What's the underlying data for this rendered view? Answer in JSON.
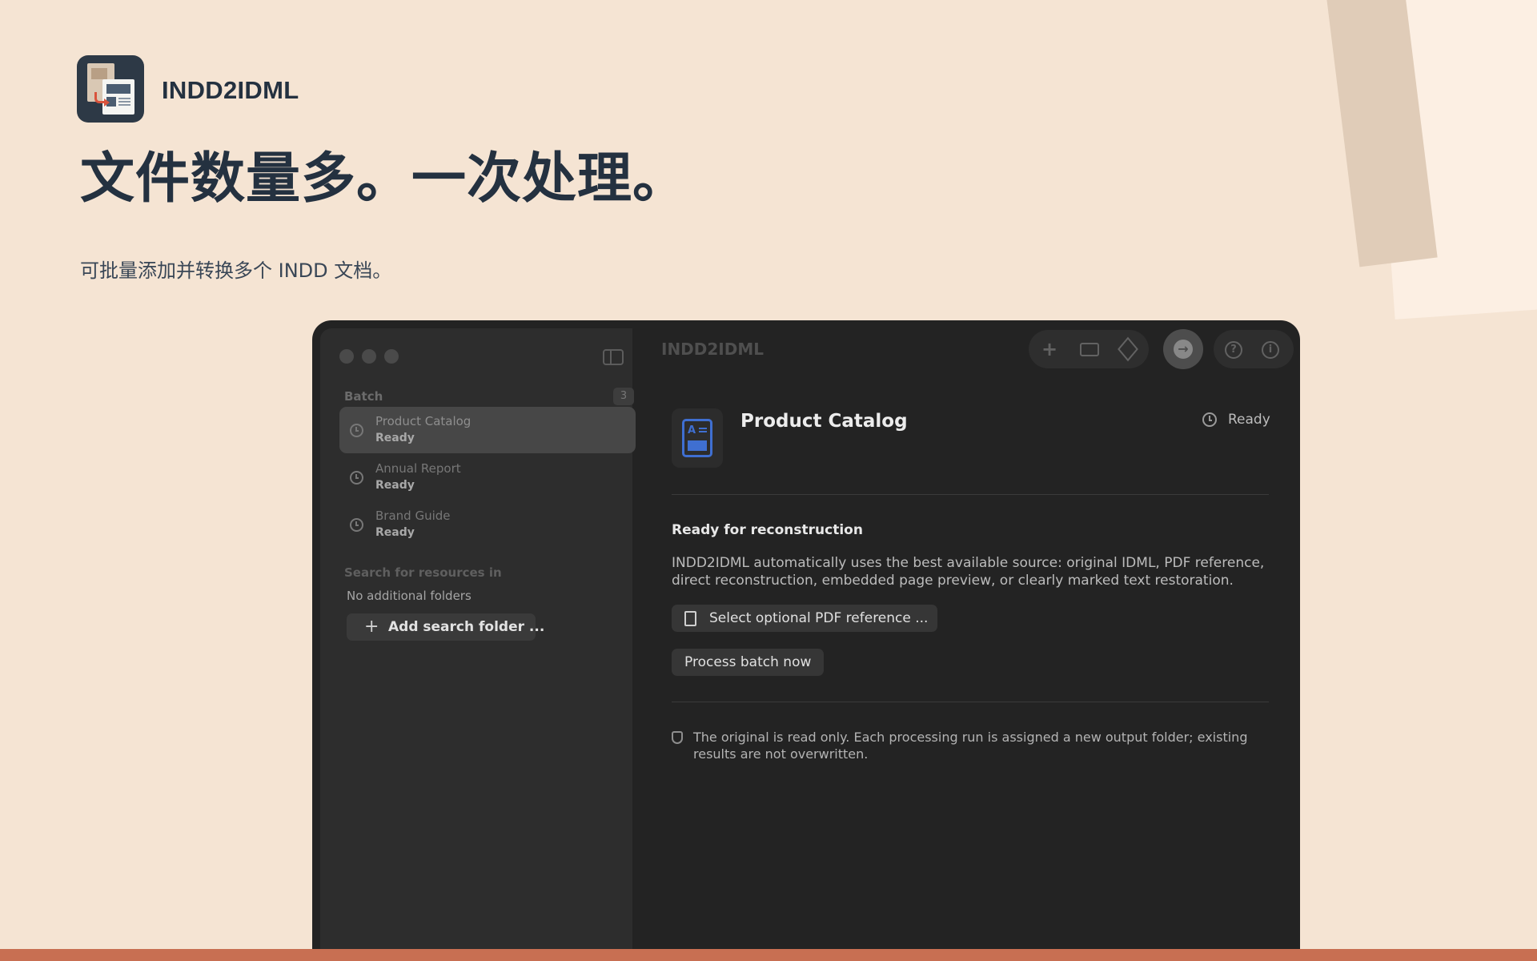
{
  "app": {
    "name": "INDD2IDML",
    "headline": "文件数量多。一次处理。",
    "subline": "可批量添加并转换多个 INDD 文档。"
  },
  "window": {
    "title": "INDD2IDML",
    "toolbar": {
      "icons": [
        "plus-icon",
        "folder-icon",
        "package-icon",
        "process-icon",
        "help-icon",
        "info-icon"
      ]
    }
  },
  "sidebar": {
    "batch_header": "Batch",
    "batch_count": "3",
    "items": [
      {
        "title": "Product Catalog",
        "status": "Ready",
        "selected": true
      },
      {
        "title": "Annual Report",
        "status": "Ready",
        "selected": false
      },
      {
        "title": "Brand Guide",
        "status": "Ready",
        "selected": false
      }
    ],
    "search_header": "Search for resources in",
    "no_folders": "No additional folders",
    "add_folder_label": "Add search folder ..."
  },
  "detail": {
    "title": "Product Catalog",
    "status": "Ready",
    "section_heading": "Ready for reconstruction",
    "section_text": "INDD2IDML automatically uses the best available source: original IDML, PDF reference, direct reconstruction, embedded page preview, or clearly marked text restoration.",
    "pdf_button": "Select optional PDF reference ...",
    "process_button": "Process batch now",
    "note": "The original is read only. Each processing run is assigned a new output folder; existing results are not overwritten."
  },
  "colors": {
    "background": "#f5e4d3",
    "accent_strip": "#c86f52",
    "doc_icon_blue": "#3f6fd1",
    "window": "#232323"
  }
}
